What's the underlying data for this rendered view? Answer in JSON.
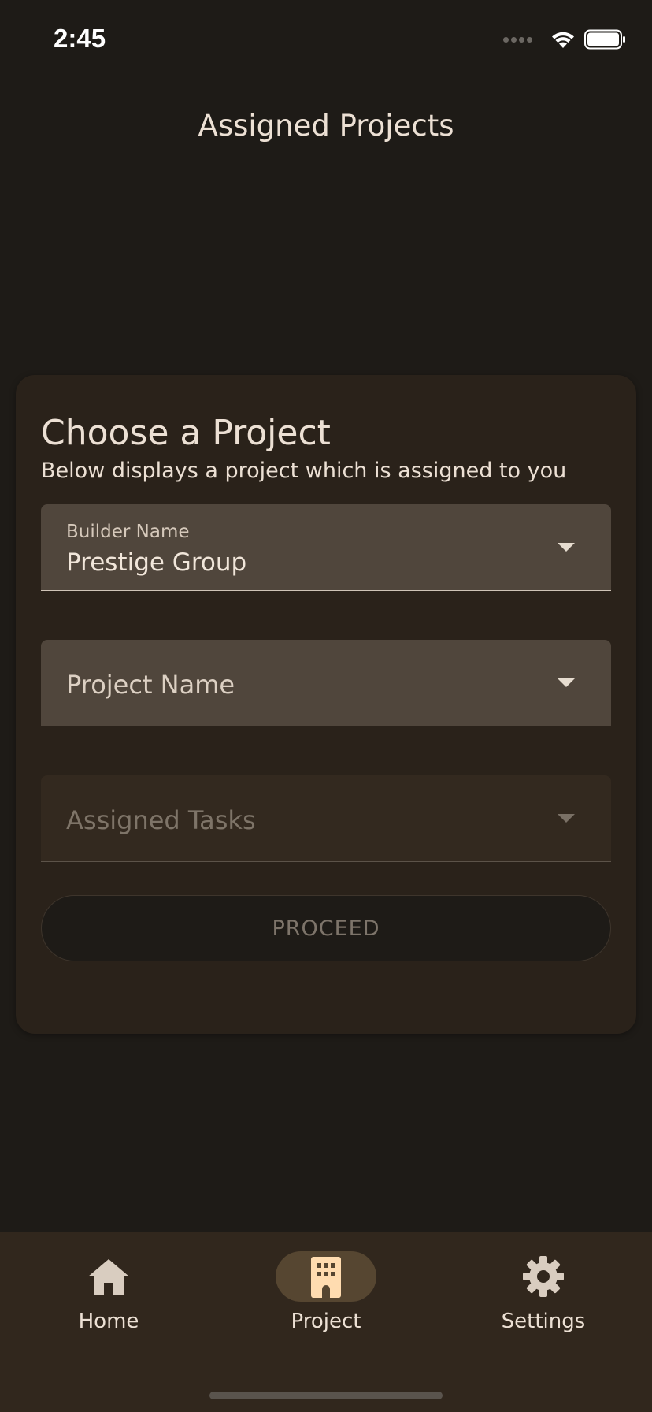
{
  "status_bar": {
    "time": "2:45"
  },
  "header": {
    "title": "Assigned Projects"
  },
  "card": {
    "title": "Choose a Project",
    "subtitle": "Below displays a project which is assigned to you",
    "builder_dropdown": {
      "label": "Builder Name",
      "value": "Prestige Group"
    },
    "project_dropdown": {
      "placeholder": "Project Name"
    },
    "tasks_dropdown": {
      "placeholder": "Assigned Tasks",
      "disabled": true
    },
    "proceed_label": "PROCEED"
  },
  "bottom_nav": {
    "items": [
      {
        "label": "Home",
        "icon": "home-icon",
        "active": false
      },
      {
        "label": "Project",
        "icon": "building-icon",
        "active": true
      },
      {
        "label": "Settings",
        "icon": "gear-icon",
        "active": false
      }
    ]
  },
  "colors": {
    "background": "#1e1b17",
    "card": "#2a221a",
    "field": "#50463c",
    "nav_bar": "#31271d",
    "nav_active_pill": "#564631",
    "accent_icon": "#ffdcb0"
  }
}
